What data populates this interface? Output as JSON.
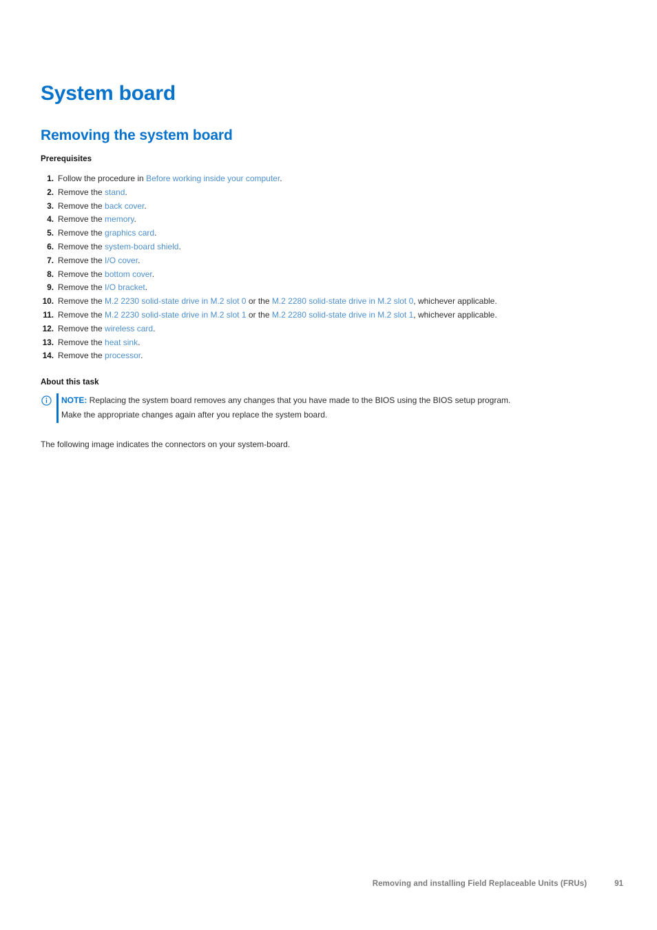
{
  "headings": {
    "h1": "System board",
    "h2": "Removing the system board"
  },
  "colors": {
    "heading_blue": "#0672cb",
    "link_blue": "#4d8fcc",
    "body_text": "#2b2b2b",
    "footer_gray": "#7a7a7a",
    "page_background": "#ffffff"
  },
  "prerequisites": {
    "label": "Prerequisites",
    "steps": [
      {
        "num": "1.",
        "parts": [
          {
            "text": "Follow the procedure in ",
            "link": false
          },
          {
            "text": "Before working inside your computer",
            "link": true
          },
          {
            "text": ".",
            "link": false
          }
        ]
      },
      {
        "num": "2.",
        "parts": [
          {
            "text": "Remove the ",
            "link": false
          },
          {
            "text": "stand",
            "link": true
          },
          {
            "text": ".",
            "link": false
          }
        ]
      },
      {
        "num": "3.",
        "parts": [
          {
            "text": "Remove the ",
            "link": false
          },
          {
            "text": "back cover",
            "link": true
          },
          {
            "text": ".",
            "link": false
          }
        ]
      },
      {
        "num": "4.",
        "parts": [
          {
            "text": "Remove the ",
            "link": false
          },
          {
            "text": "memory",
            "link": true
          },
          {
            "text": ".",
            "link": false
          }
        ]
      },
      {
        "num": "5.",
        "parts": [
          {
            "text": "Remove the ",
            "link": false
          },
          {
            "text": "graphics card",
            "link": true
          },
          {
            "text": ".",
            "link": false
          }
        ]
      },
      {
        "num": "6.",
        "parts": [
          {
            "text": "Remove the ",
            "link": false
          },
          {
            "text": "system-board shield",
            "link": true
          },
          {
            "text": ".",
            "link": false
          }
        ]
      },
      {
        "num": "7.",
        "parts": [
          {
            "text": "Remove the ",
            "link": false
          },
          {
            "text": "I/O cover",
            "link": true
          },
          {
            "text": ".",
            "link": false
          }
        ]
      },
      {
        "num": "8.",
        "parts": [
          {
            "text": "Remove the ",
            "link": false
          },
          {
            "text": "bottom cover",
            "link": true
          },
          {
            "text": ".",
            "link": false
          }
        ]
      },
      {
        "num": "9.",
        "parts": [
          {
            "text": "Remove the ",
            "link": false
          },
          {
            "text": "I/O bracket",
            "link": true
          },
          {
            "text": ".",
            "link": false
          }
        ]
      },
      {
        "num": "10.",
        "parts": [
          {
            "text": "Remove the ",
            "link": false
          },
          {
            "text": "M.2 2230 solid-state drive in M.2 slot 0",
            "link": true
          },
          {
            "text": " or the ",
            "link": false
          },
          {
            "text": "M.2 2280 solid-state drive in M.2 slot 0",
            "link": true
          },
          {
            "text": ", whichever applicable.",
            "link": false
          }
        ]
      },
      {
        "num": "11.",
        "parts": [
          {
            "text": "Remove the ",
            "link": false
          },
          {
            "text": "M.2 2230 solid-state drive in M.2 slot 1",
            "link": true
          },
          {
            "text": " or the ",
            "link": false
          },
          {
            "text": "M.2 2280 solid-state drive in M.2 slot 1",
            "link": true
          },
          {
            "text": ", whichever applicable.",
            "link": false
          }
        ]
      },
      {
        "num": "12.",
        "parts": [
          {
            "text": "Remove the ",
            "link": false
          },
          {
            "text": "wireless card",
            "link": true
          },
          {
            "text": ".",
            "link": false
          }
        ]
      },
      {
        "num": "13.",
        "parts": [
          {
            "text": "Remove the ",
            "link": false
          },
          {
            "text": "heat sink",
            "link": true
          },
          {
            "text": ".",
            "link": false
          }
        ]
      },
      {
        "num": "14.",
        "parts": [
          {
            "text": "Remove the ",
            "link": false
          },
          {
            "text": "processor",
            "link": true
          },
          {
            "text": ".",
            "link": false
          }
        ]
      }
    ]
  },
  "about_this_task": {
    "label": "About this task",
    "note": {
      "icon": "info-circle-icon",
      "label": "NOTE:",
      "line1": " Replacing the system board removes any changes that you have made to the BIOS using the BIOS setup program.",
      "line2": "Make the appropriate changes again after you replace the system board."
    },
    "paragraph": "The following image indicates the connectors on your system-board."
  },
  "footer": {
    "text": "Removing and installing Field Replaceable Units (FRUs)",
    "page_number": "91"
  }
}
